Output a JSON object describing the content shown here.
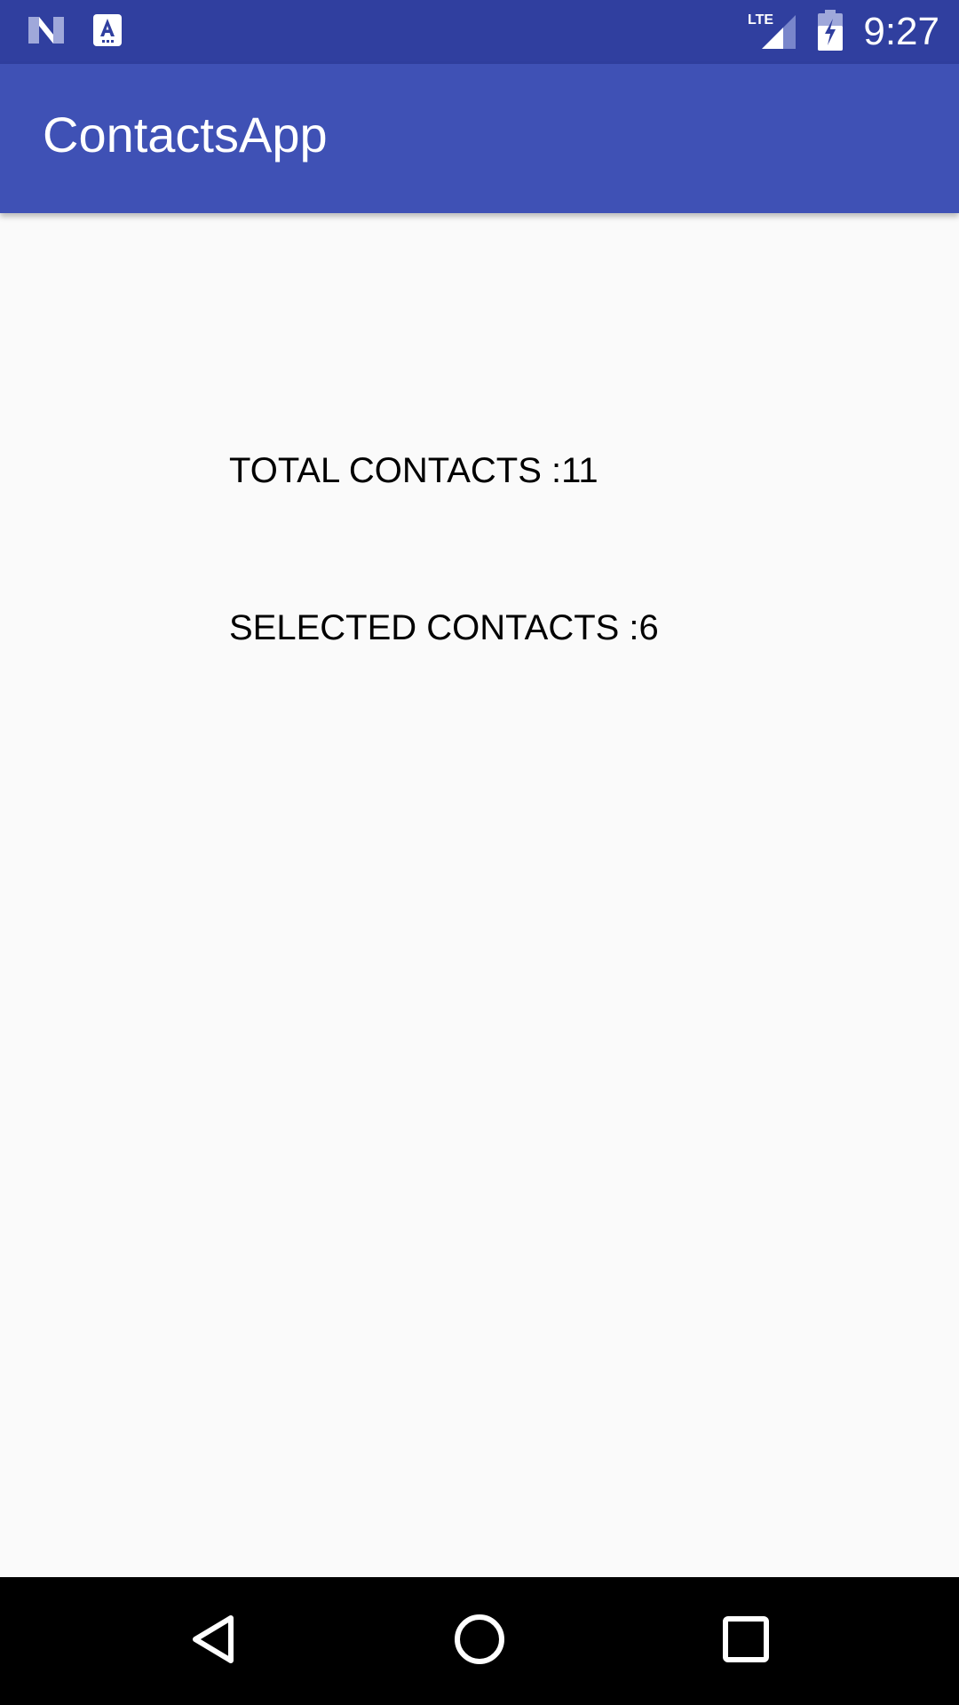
{
  "status_bar": {
    "time": "9:27",
    "network": "LTE",
    "icons": [
      "notification-n-icon",
      "app-a-icon",
      "lte-signal-icon",
      "battery-charging-icon"
    ],
    "color": "#303f9f"
  },
  "app_bar": {
    "title": "ContactsApp",
    "color": "#3f51b5"
  },
  "main": {
    "total_contacts": "TOTAL CONTACTS :11",
    "selected_contacts": "SELECTED CONTACTS :6"
  },
  "nav_bar": {
    "icons": [
      "back-icon",
      "home-icon",
      "recents-icon"
    ]
  }
}
